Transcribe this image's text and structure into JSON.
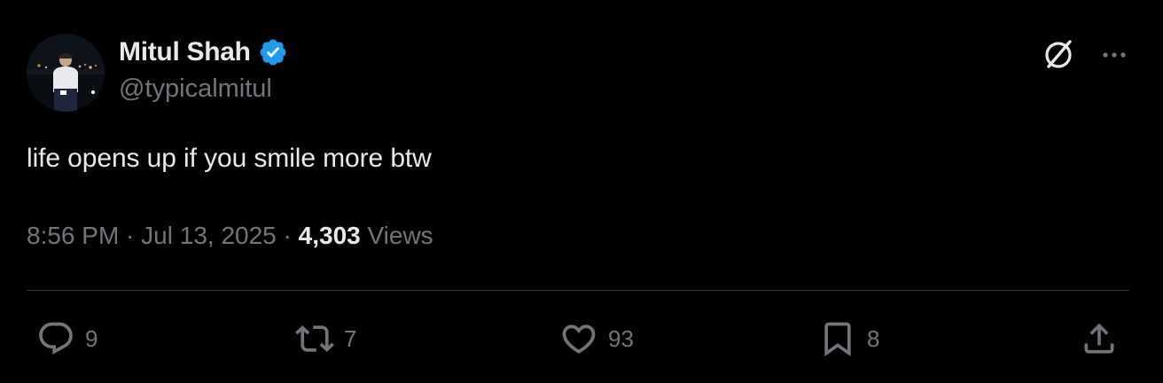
{
  "author": {
    "display_name": "Mitul Shah",
    "handle": "@typicalmitul",
    "verified": true
  },
  "tweet": {
    "text": "life opens up if you smile more btw",
    "time": "8:56 PM",
    "separator": " · ",
    "date": "Jul 13, 2025",
    "views_count": "4,303",
    "views_label": "Views"
  },
  "actions": {
    "replies": "9",
    "reposts": "7",
    "likes": "93",
    "bookmarks": "8"
  },
  "icons": {
    "verified": "verified-badge-icon",
    "grok": "grok-icon",
    "more": "more-icon",
    "reply": "reply-icon",
    "repost": "repost-icon",
    "like": "heart-icon",
    "bookmark": "bookmark-icon",
    "share": "share-icon"
  },
  "colors": {
    "background": "#000000",
    "text_primary": "#e7e9ea",
    "text_secondary": "#71767b",
    "verified_blue": "#1d9bf0",
    "divider": "#2f3336"
  }
}
